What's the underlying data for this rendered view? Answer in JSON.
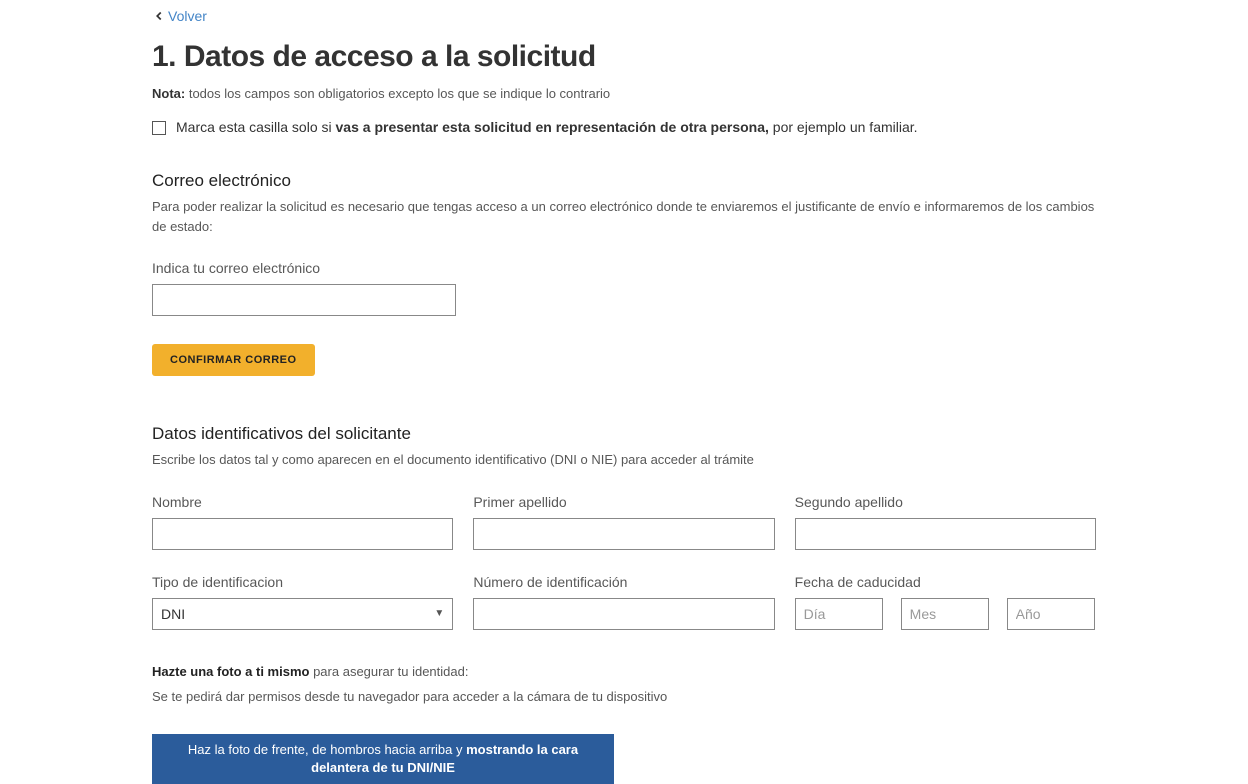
{
  "back": {
    "label": "Volver"
  },
  "title": "1. Datos de acceso a la solicitud",
  "note": {
    "prefix": "Nota:",
    "text": " todos los campos son obligatorios excepto los que se indique lo contrario"
  },
  "representation_checkbox": {
    "pre": "Marca esta casilla solo si ",
    "bold": "vas a presentar esta solicitud en representación de otra persona,",
    "post": " por ejemplo un familiar."
  },
  "email_section": {
    "title": "Correo electrónico",
    "desc": "Para poder realizar la solicitud es necesario que tengas acceso a un correo electrónico donde te enviaremos el justificante de envío e informaremos de los cambios de estado:",
    "label": "Indica tu correo electrónico",
    "confirm_button": "CONFIRMAR CORREO"
  },
  "id_section": {
    "title": "Datos identificativos del solicitante",
    "desc": "Escribe los datos tal y como aparecen en el documento identificativo (DNI o NIE) para acceder al trámite",
    "nombre_label": "Nombre",
    "apellido1_label": "Primer apellido",
    "apellido2_label": "Segundo apellido",
    "tipo_label": "Tipo de identificacion",
    "tipo_value": "DNI",
    "numero_label": "Número de identificación",
    "fecha_label": "Fecha de caducidad",
    "dia_ph": "Día",
    "mes_ph": "Mes",
    "ano_ph": "Año"
  },
  "photo_section": {
    "line1_bold": "Hazte una foto a ti mismo",
    "line1_rest": " para asegurar tu identidad:",
    "line2": "Se te pedirá dar permisos desde tu navegador para acceder a la cámara de tu dispositivo",
    "banner_pre": "Haz la foto de frente, de hombros hacia arriba y ",
    "banner_bold": "mostrando la cara delantera de tu DNI/NIE"
  }
}
